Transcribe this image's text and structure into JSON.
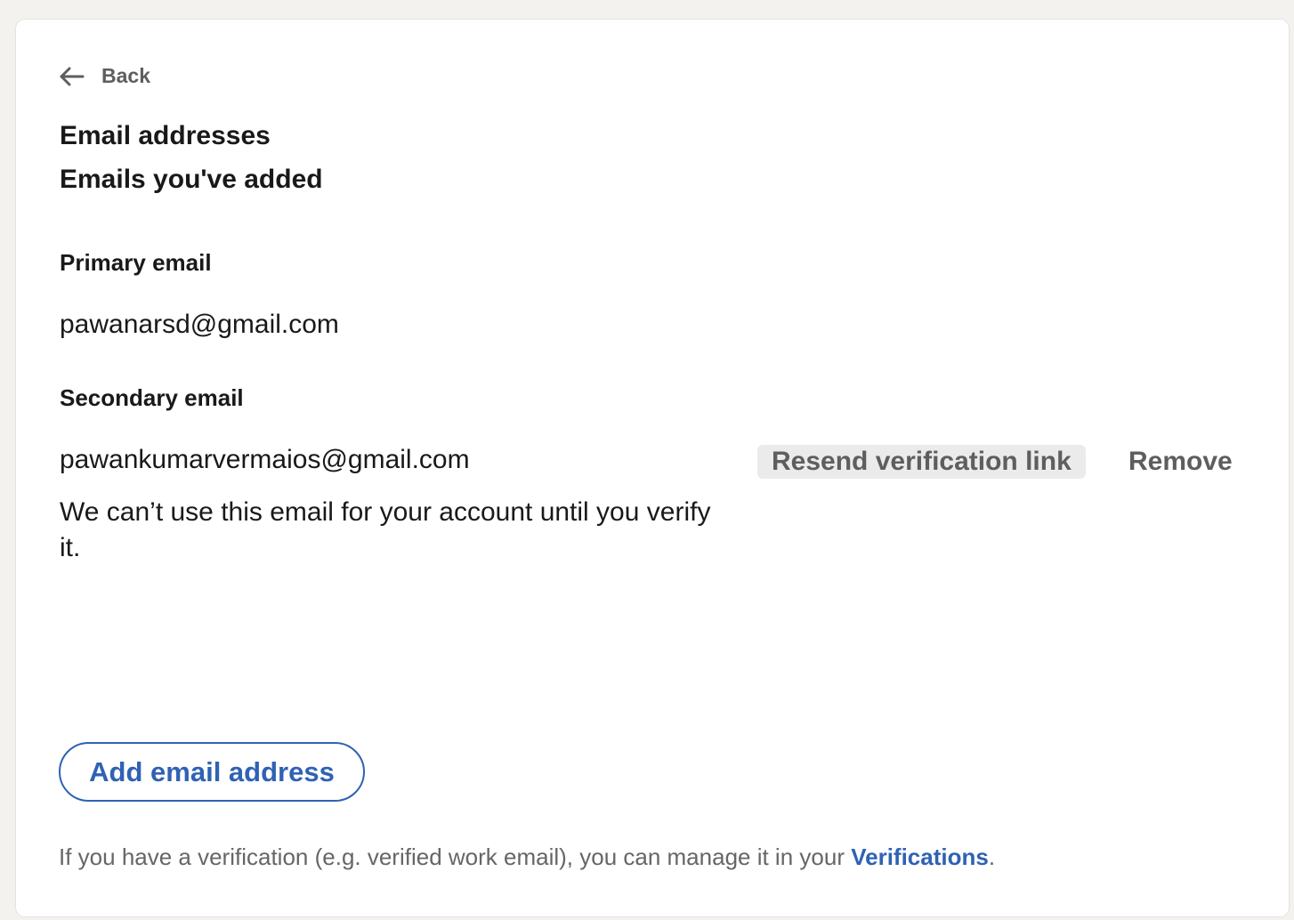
{
  "back": {
    "label": "Back"
  },
  "header": {
    "title": "Email addresses",
    "subtitle": "Emails you've added"
  },
  "primary": {
    "label": "Primary email",
    "email": "pawanarsd@gmail.com"
  },
  "secondary": {
    "label": "Secondary email",
    "email": "pawankumarvermaios@gmail.com",
    "note": "We can’t use this email for your account until you verify it.",
    "resend_label": "Resend verification link",
    "remove_label": "Remove"
  },
  "add_button": {
    "label": "Add email address"
  },
  "footer": {
    "text": "If you have a verification (e.g. verified work email), you can manage it in your ",
    "link": "Verifications",
    "suffix": "."
  },
  "colors": {
    "accent": "#2f62b4",
    "muted": "#5e5e5e",
    "background": "#f3f2ef"
  }
}
